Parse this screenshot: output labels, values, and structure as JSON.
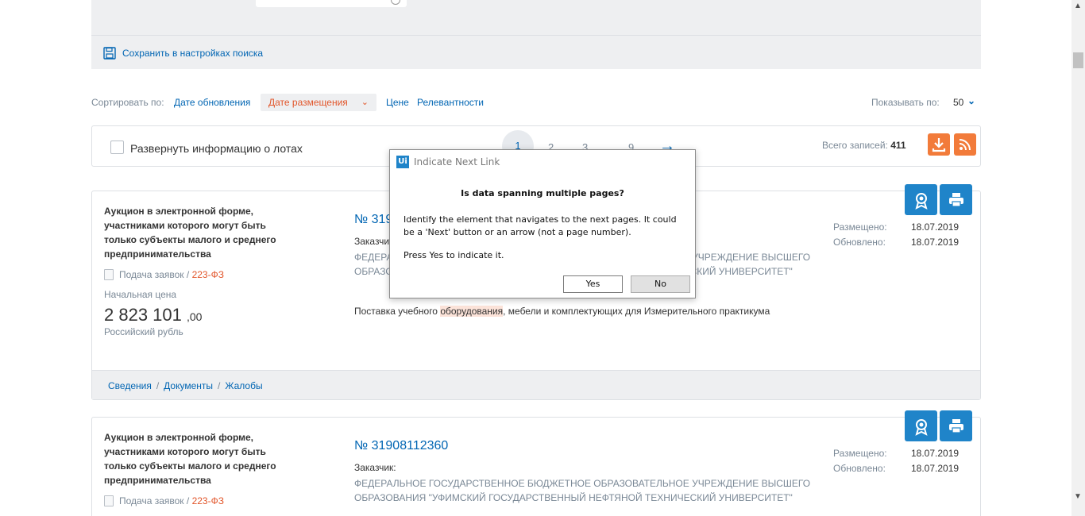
{
  "search": {
    "save_label": "Сохранить в настройках поиска"
  },
  "sort": {
    "label": "Сортировать по:",
    "options": [
      "Дате обновления",
      "Дате размещения",
      "Цене",
      "Релевантности"
    ],
    "active": "Дате размещения",
    "show_label": "Показывать по:",
    "show_value": "50"
  },
  "toolbar": {
    "expand_label": "Развернуть информацию о лотах",
    "pages": [
      "1",
      "2",
      "3",
      "...",
      "9"
    ],
    "next": "→",
    "total_label": "Всего записей:",
    "total_value": "411"
  },
  "records": [
    {
      "type": "Аукцион в электронной форме, участниками которого могут быть только субъекты малого и среднего предпринимательства",
      "stage": "Подача заявок",
      "law": "223-ФЗ",
      "price_label": "Начальная цена",
      "price_int": "2 823 101",
      "price_dec": ",00",
      "currency": "Российский рубль",
      "number": "№ 3190",
      "customer_label": "Заказчик:",
      "customer": "ФЕДЕРАЛЬНОЕ ГОСУДАРСТВЕННОЕ БЮДЖЕТНОЕ ОБРАЗОВАТЕЛЬНОЕ УЧРЕЖДЕНИЕ ВЫСШЕГО ОБРАЗОВАНИЯ \"УФИМСКИЙ ГОСУДАРСТВЕННЫЙ НЕФТЯНОЙ ТЕХНИЧЕСКИЙ УНИВЕРСИТЕТ\"",
      "subject_pre": "Поставка учебного ",
      "subject_mark": "оборудования",
      "subject_post": ", мебели и комплектующих для Измерительного практикума",
      "posted_label": "Размещено:",
      "posted": "18.07.2019",
      "updated_label": "Обновлено:",
      "updated": "18.07.2019",
      "links": [
        "Сведения",
        "Документы",
        "Жалобы"
      ]
    },
    {
      "type": "Аукцион в электронной форме, участниками которого могут быть только субъекты малого и среднего предпринимательства",
      "stage": "Подача заявок",
      "law": "223-ФЗ",
      "number": "№ 31908112360",
      "customer_label": "Заказчик:",
      "customer": "ФЕДЕРАЛЬНОЕ ГОСУДАРСТВЕННОЕ БЮДЖЕТНОЕ ОБРАЗОВАТЕЛЬНОЕ УЧРЕЖДЕНИЕ ВЫСШЕГО ОБРАЗОВАНИЯ \"УФИМСКИЙ ГОСУДАРСТВЕННЫЙ НЕФТЯНОЙ ТЕХНИЧЕСКИЙ УНИВЕРСИТЕТ\"",
      "posted_label": "Размещено:",
      "posted": "18.07.2019",
      "updated_label": "Обновлено:",
      "updated": "18.07.2019"
    }
  ],
  "dialog": {
    "title": "Indicate Next Link",
    "logo": "Ui",
    "heading": "Is data spanning multiple pages?",
    "body": "Identify the element that navigates to the next pages. It could be a 'Next' button or an arrow (not a page number).",
    "body2": "Press Yes to indicate it.",
    "yes": "Yes",
    "no": "No"
  },
  "icons": {
    "save": "floppy-disk-icon",
    "download": "download-icon",
    "rss": "rss-icon",
    "award": "award-icon",
    "print": "print-icon",
    "doc": "document-icon"
  },
  "colors": {
    "link": "#0065b3",
    "accent_orange": "#f27b3a",
    "active_sort": "#e2562b",
    "action_blue": "#1f84c9"
  }
}
